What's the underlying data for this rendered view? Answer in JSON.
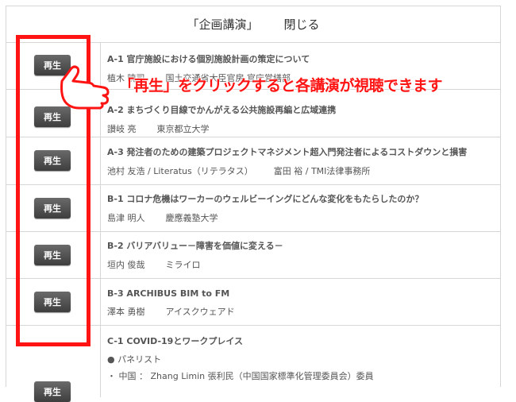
{
  "header": {
    "title": "「企画講演」",
    "close_label": "閉じる"
  },
  "play_label": "再生",
  "callout": "「再生」をクリックすると各講演が視聴できます",
  "sessions": [
    {
      "title": "A-1 官庁施設における個別施設計画の策定について",
      "name": "植木 暁司",
      "org": "国土交通省大臣官房 官庁営繕部"
    },
    {
      "title": "A-2 まちづくり目線でかんがえる公共施設再編と広域連携",
      "name": "讃岐 亮",
      "org": "東京都立大学"
    },
    {
      "title": "A-3 発注者のための建築プロジェクトマネジメント超入門発注者によるコストダウンと損害",
      "name": "池村 友浩 / Literatus（リテラタス）",
      "org": "富田 裕 / TMI法律事務所"
    },
    {
      "title": "B-1 コロナ危機はワーカーのウェルビーイングにどんな変化をもたらしたのか？",
      "name": "島津 明人",
      "org": "慶應義塾大学"
    },
    {
      "title": "B-2 バリアバリュー－障害を価値に変える－",
      "name": "垣内 俊哉",
      "org": "ミライロ"
    },
    {
      "title": "B-3 ARCHIBUS BIM to FM",
      "name": "澤本 勇樹",
      "org": "アイスクウェアド"
    },
    {
      "title": "C-1 COVID-19とワークプレイス",
      "panel_label": "● パネリスト",
      "panel_member": "・ 中国 ： Zhang Limin 張利民（中国国家標準化管理委員会）委員"
    }
  ],
  "colors": {
    "accent_red": "#ff1414",
    "button_bg": "#4a4a4a",
    "border": "#d6d6d6"
  },
  "icons": {
    "pointer": "hand-pointer-icon"
  }
}
